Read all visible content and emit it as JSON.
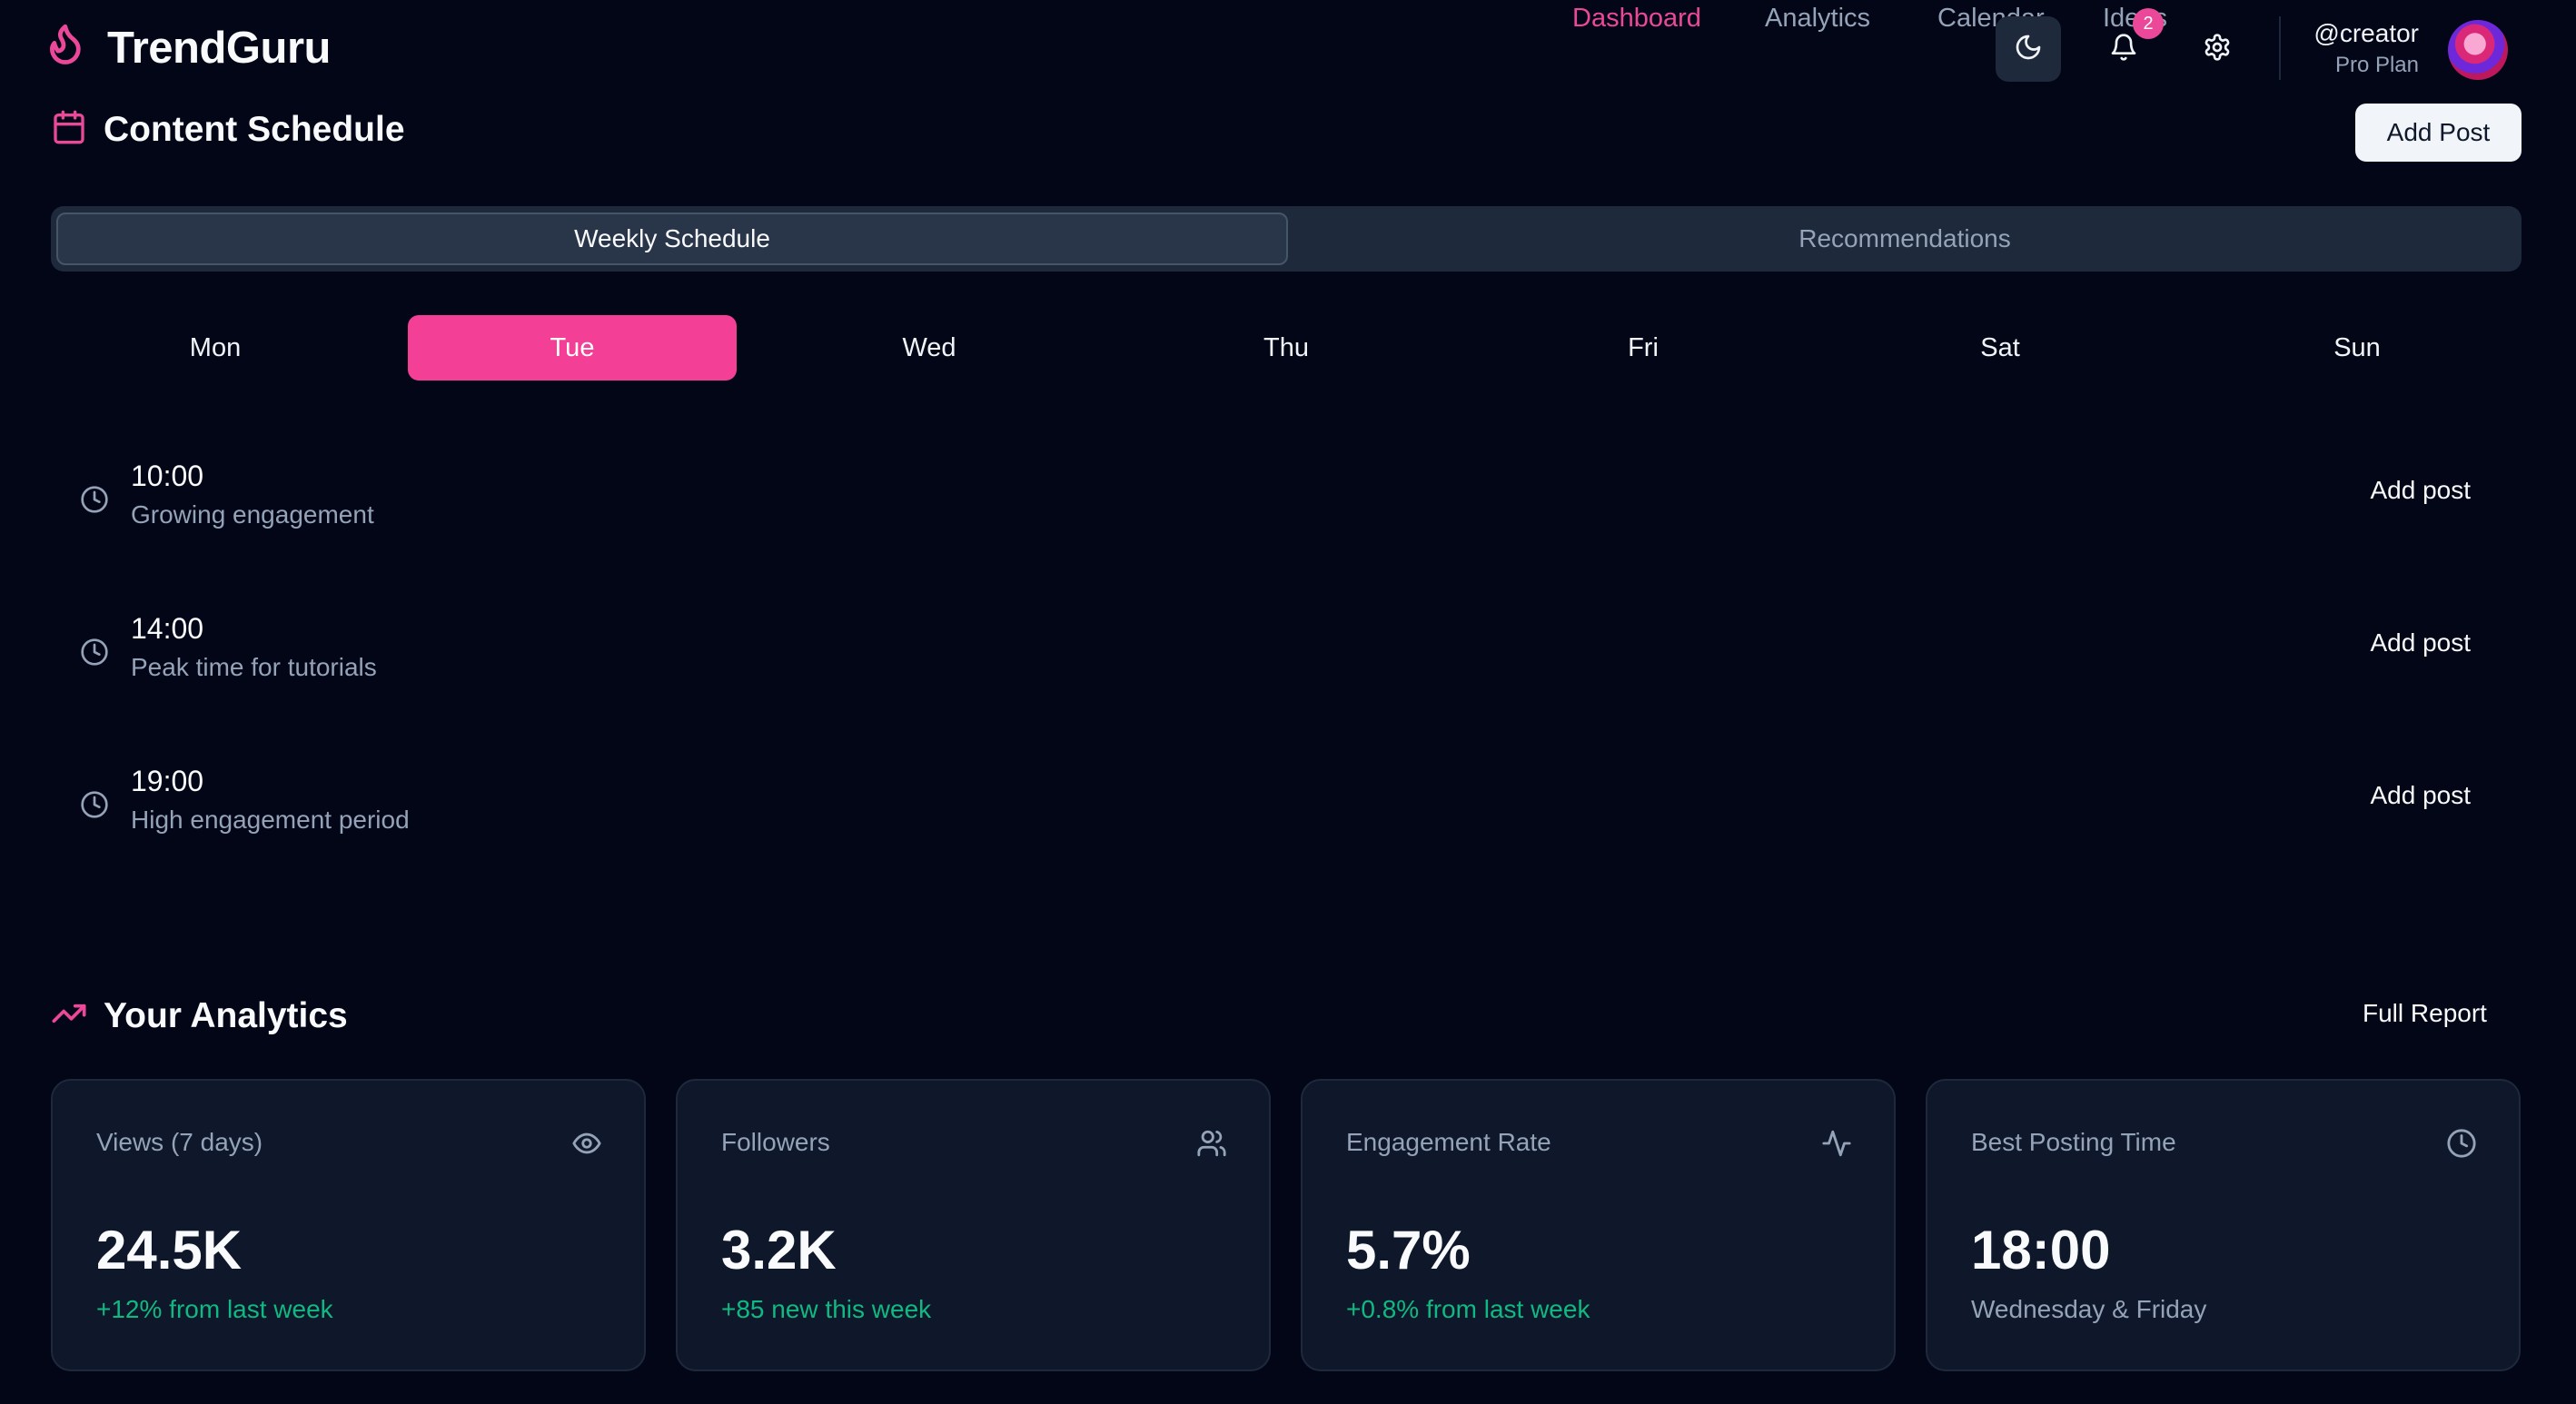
{
  "app": {
    "name": "TrendGuru"
  },
  "nav": {
    "links": [
      {
        "label": "Dashboard",
        "active": true
      },
      {
        "label": "Analytics",
        "active": false
      },
      {
        "label": "Calendar",
        "active": false
      },
      {
        "label": "Ideas",
        "active": false
      }
    ],
    "notification_count": "2",
    "icons": [
      "moon-icon",
      "bell-icon",
      "gear-icon"
    ]
  },
  "user": {
    "handle": "@creator",
    "plan": "Pro Plan"
  },
  "schedule": {
    "title": "Content Schedule",
    "add_button": "Add Post",
    "tabs": [
      {
        "label": "Weekly Schedule",
        "active": true
      },
      {
        "label": "Recommendations",
        "active": false
      }
    ],
    "days": [
      {
        "label": "Mon",
        "active": false
      },
      {
        "label": "Tue",
        "active": true
      },
      {
        "label": "Wed",
        "active": false
      },
      {
        "label": "Thu",
        "active": false
      },
      {
        "label": "Fri",
        "active": false
      },
      {
        "label": "Sat",
        "active": false
      },
      {
        "label": "Sun",
        "active": false
      }
    ],
    "slots": [
      {
        "time": "10:00",
        "description": "Growing engagement",
        "action": "Add post"
      },
      {
        "time": "14:00",
        "description": "Peak time for tutorials",
        "action": "Add post"
      },
      {
        "time": "19:00",
        "description": "High engagement period",
        "action": "Add post"
      }
    ]
  },
  "analytics": {
    "title": "Your Analytics",
    "full_report": "Full Report",
    "cards": [
      {
        "label": "Views (7 days)",
        "value": "24.5K",
        "sub": "+12% from last week",
        "icon": "eye-icon"
      },
      {
        "label": "Followers",
        "value": "3.2K",
        "sub": "+85 new this week",
        "icon": "users-icon"
      },
      {
        "label": "Engagement Rate",
        "value": "5.7%",
        "sub": "+0.8% from last week",
        "icon": "activity-icon"
      },
      {
        "label": "Best Posting Time",
        "value": "18:00",
        "sub": "Wednesday & Friday",
        "icon": "clock-icon"
      }
    ]
  },
  "colors": {
    "background": "#020617",
    "accent": "#ec4899",
    "card": "#0f172a",
    "positive": "#10b981",
    "muted": "#94a3b8"
  }
}
